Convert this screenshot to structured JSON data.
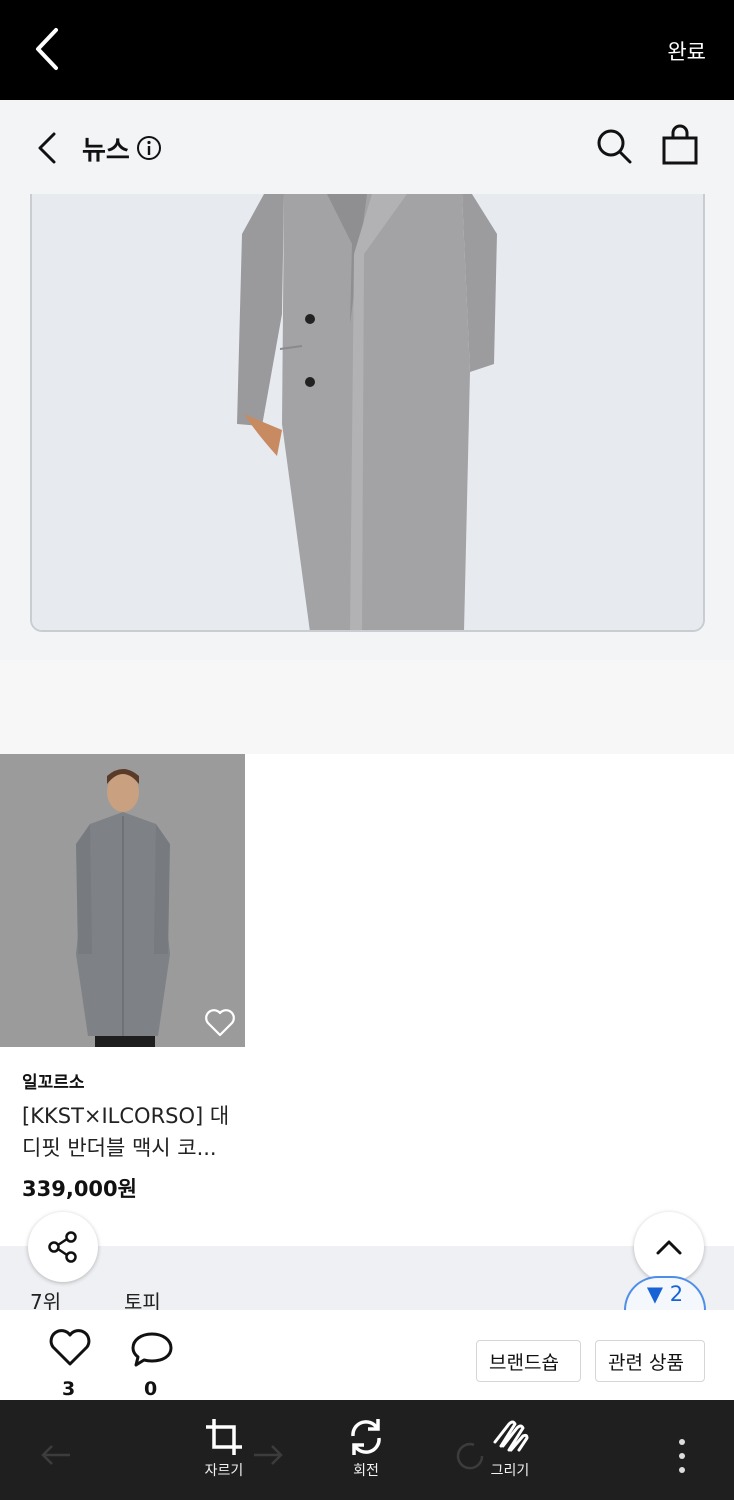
{
  "editor": {
    "done_label": "완료",
    "tools": [
      {
        "label": "자르기",
        "icon": "crop-icon"
      },
      {
        "label": "회전",
        "icon": "rotate-icon"
      },
      {
        "label": "그리기",
        "icon": "draw-icon"
      }
    ]
  },
  "header": {
    "title": "뉴스",
    "icons": [
      "back-icon",
      "info-icon",
      "search-icon",
      "shopping-bag-icon"
    ]
  },
  "banner": {
    "image": "model wearing long grey double-breasted wool coat"
  },
  "product": {
    "image": "model in grey long coat on grey background",
    "brand": "일꼬르소",
    "title": "[KKST×ILCORSO] 대디핏 반더블 맥시 코...",
    "price": "339,000원",
    "wishlisted": false
  },
  "info_strip": {
    "rank": "7위",
    "topic": "토피",
    "badge": "▼ 2"
  },
  "actions": {
    "like_count": "3",
    "comment_count": "0",
    "brandshop_label": "브랜드숍",
    "related_label": "관련 상품"
  },
  "colors": {
    "editor_bar": "#000000",
    "toolbar": "#1f1f1f",
    "header_bg": "#f3f4f6",
    "badge_blue": "#1763d6"
  }
}
